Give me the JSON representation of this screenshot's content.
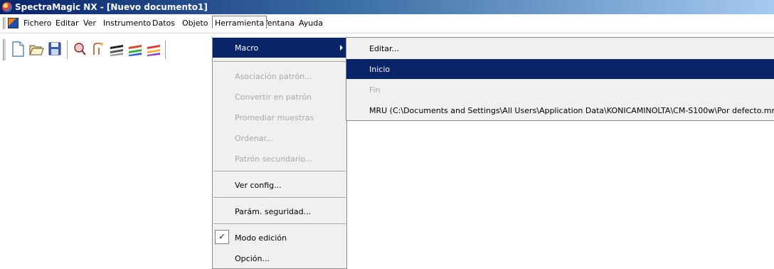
{
  "window": {
    "title": "SpectraMagic NX - [Nuevo documento1]"
  },
  "menubar": {
    "items": [
      {
        "label": "Fichero"
      },
      {
        "label": "Editar"
      },
      {
        "label": "Ver"
      },
      {
        "label": "Instrumento"
      },
      {
        "label": "Datos"
      },
      {
        "label": "Objeto"
      },
      {
        "label": "Herramienta"
      },
      {
        "label": "Ventana"
      },
      {
        "label": "Ayuda"
      }
    ],
    "active": "Herramienta"
  },
  "toolbar": {
    "buttons": [
      "new-icon",
      "open-icon",
      "save-icon",
      "measure-icon",
      "calibrate-icon",
      "color-stack-icon",
      "color-stack-2-icon",
      "color-stack-3-icon"
    ]
  },
  "herramienta_menu": {
    "items": [
      {
        "label": "Macro",
        "state": "highlighted",
        "submenu": true
      },
      {
        "label": "Asociación patrón...",
        "state": "disabled"
      },
      {
        "label": "Convertir en patrón",
        "state": "disabled"
      },
      {
        "label": "Promediar muestras",
        "state": "disabled"
      },
      {
        "label": "Ordenar...",
        "state": "disabled"
      },
      {
        "label": "Patrón secundario...",
        "state": "disabled"
      },
      {
        "label": "Ver config...",
        "state": "enabled"
      },
      {
        "label": "Parám. seguridad...",
        "state": "enabled"
      },
      {
        "label": "Modo edición",
        "state": "enabled",
        "checked": true,
        "check_glyph": "✓"
      },
      {
        "label": "Opción...",
        "state": "enabled"
      }
    ]
  },
  "macro_submenu": {
    "items": [
      {
        "label": "Editar...",
        "state": "enabled"
      },
      {
        "label": "Inicio",
        "state": "highlighted"
      },
      {
        "label": "Fin",
        "state": "disabled"
      },
      {
        "label": "MRU (C:\\Documents and Settings\\All Users\\Application Data\\KONICAMINOLTA\\CM-S100w\\Por defecto.mmc)",
        "state": "enabled"
      }
    ]
  },
  "colors": {
    "title_bar_start": "#0a246a",
    "title_bar_end": "#a6caf0",
    "menu_highlight": "#0a246a",
    "menu_background": "#f0f0f0",
    "disabled_text": "#a8a8a8"
  }
}
